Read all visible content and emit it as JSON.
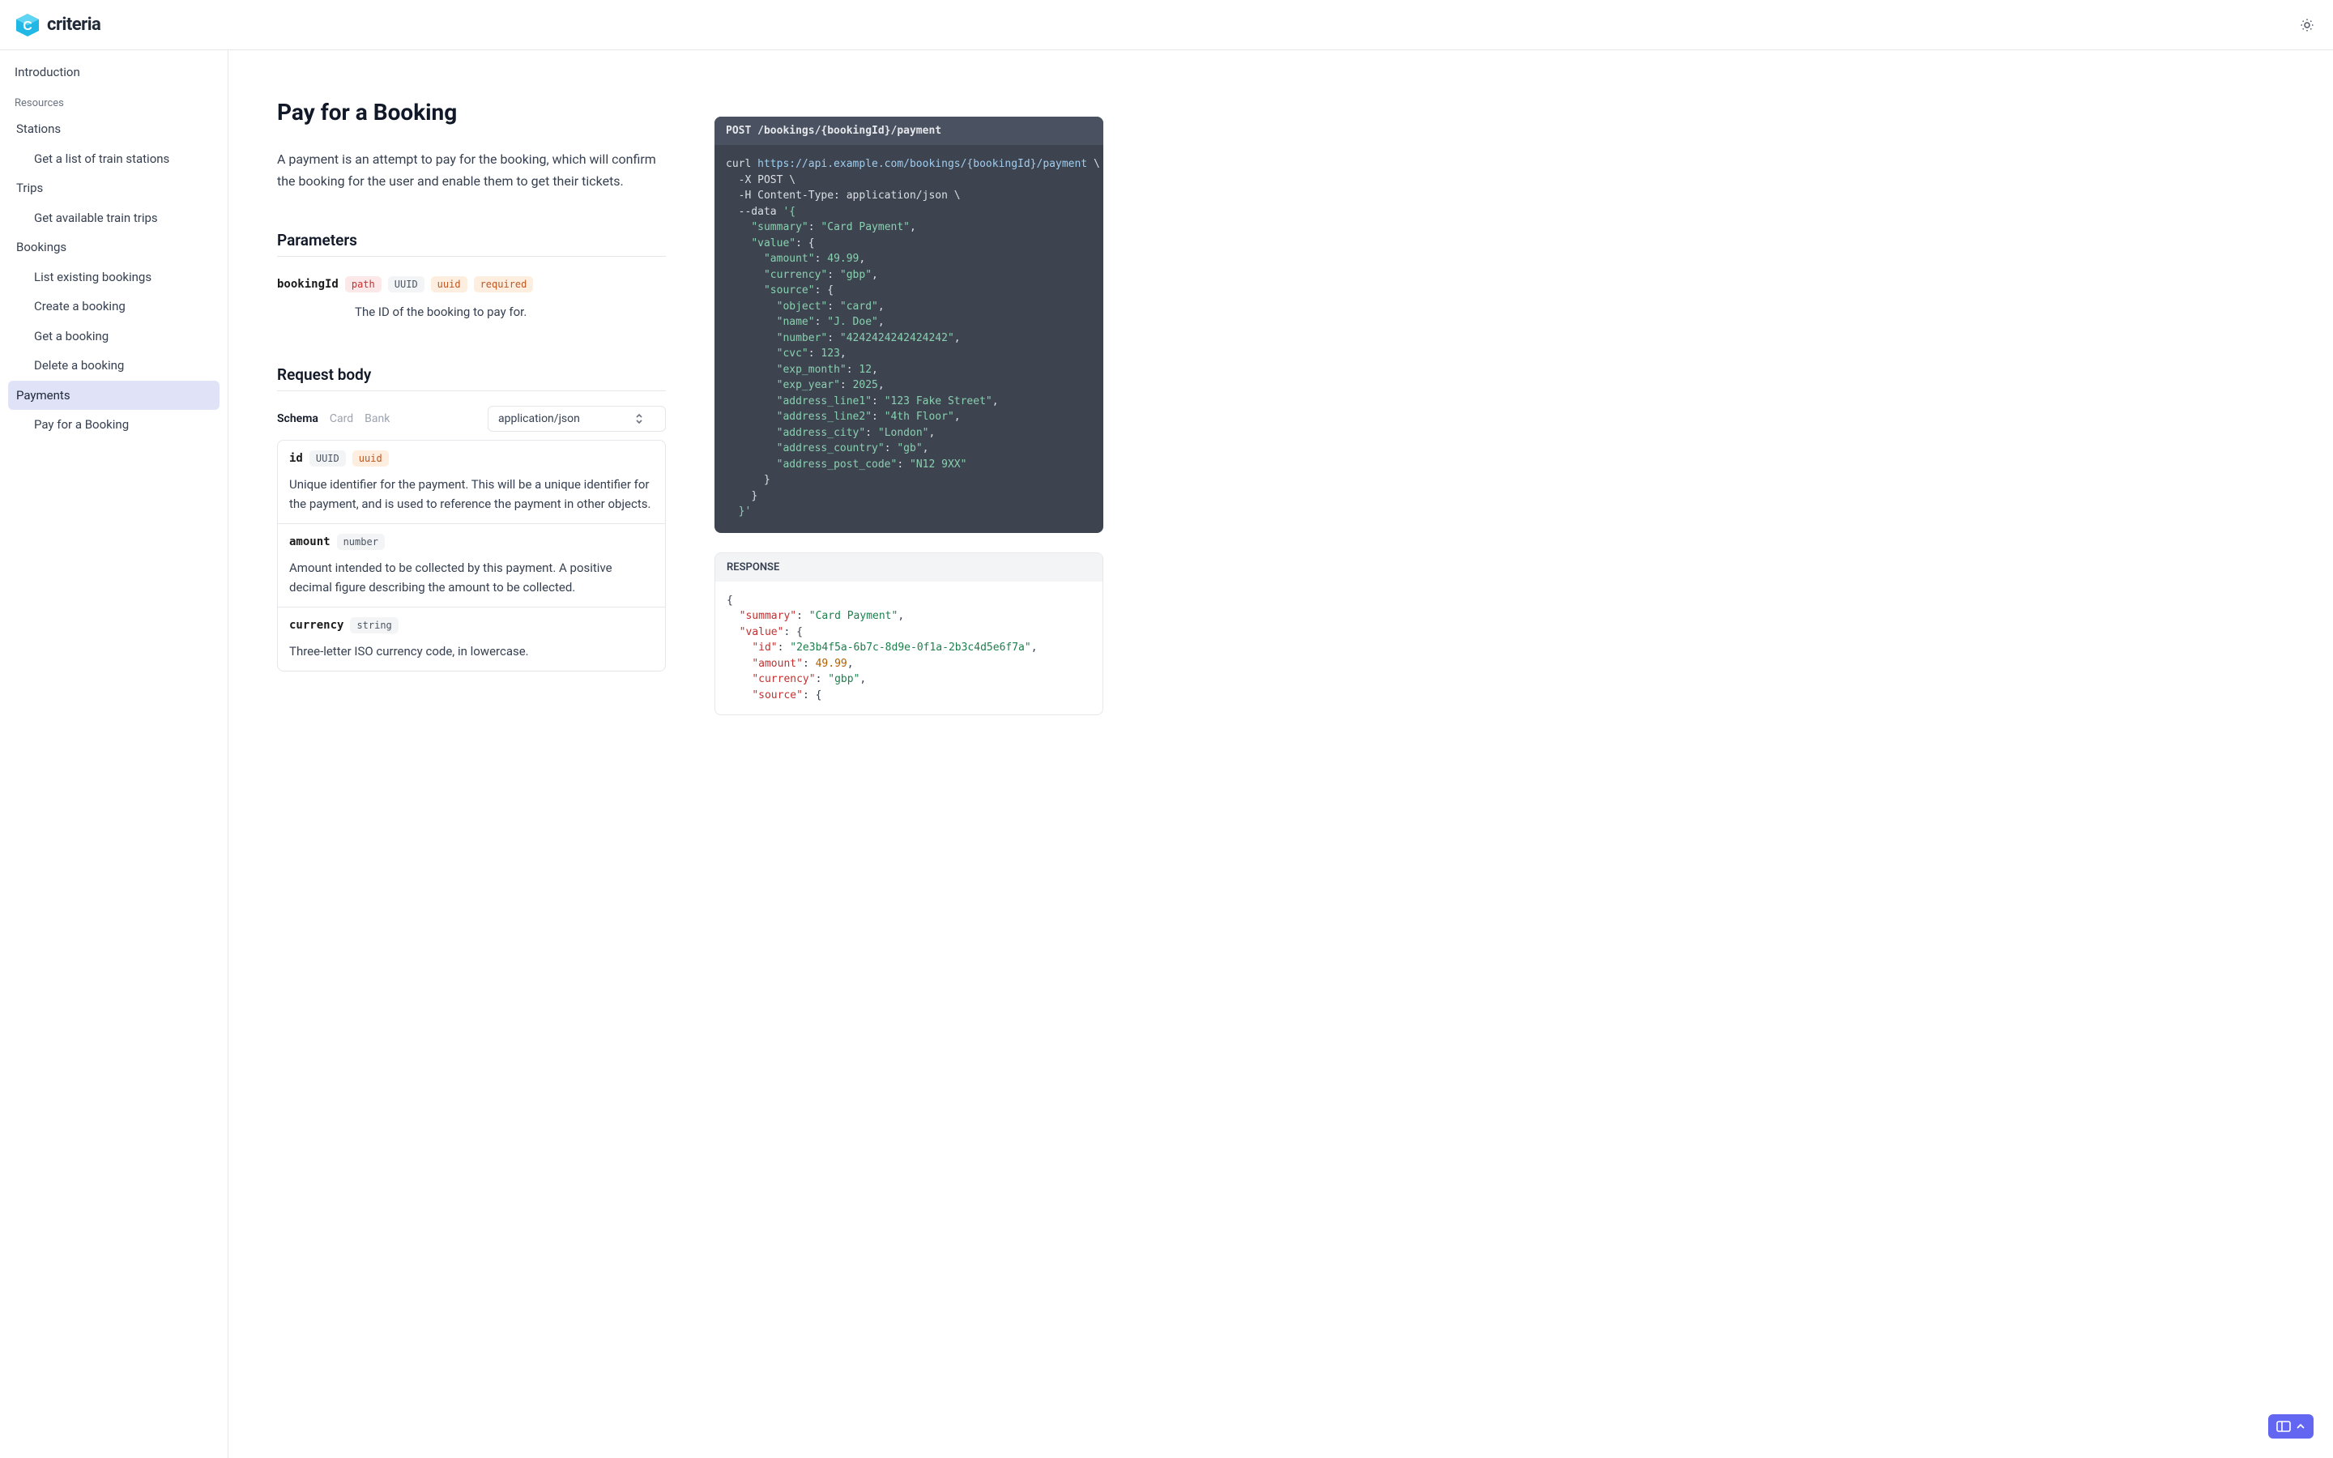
{
  "brand": "criteria",
  "sidebar": {
    "intro": "Introduction",
    "resources_label": "Resources",
    "stations": "Stations",
    "stations_list": "Get a list of train stations",
    "trips": "Trips",
    "trips_list": "Get available train trips",
    "bookings": "Bookings",
    "bookings_list": "List existing bookings",
    "bookings_create": "Create a booking",
    "bookings_get": "Get a booking",
    "bookings_delete": "Delete a booking",
    "payments": "Payments",
    "payments_pay": "Pay for a Booking"
  },
  "page": {
    "title": "Pay for a Booking",
    "description": "A payment is an attempt to pay for the booking, which will confirm the booking for the user and enable them to get their tickets.",
    "parameters_heading": "Parameters",
    "request_body_heading": "Request body"
  },
  "param": {
    "name": "bookingId",
    "chip_path": "path",
    "chip_type": "UUID",
    "chip_format": "uuid",
    "chip_required": "required",
    "desc": "The ID of the booking to pay for."
  },
  "schema_tabs": {
    "schema": "Schema",
    "card": "Card",
    "bank": "Bank"
  },
  "content_type": "application/json",
  "body_fields": {
    "id": {
      "name": "id",
      "type": "UUID",
      "format": "uuid",
      "desc": "Unique identifier for the payment. This will be a unique identifier for the payment, and is used to reference the payment in other objects."
    },
    "amount": {
      "name": "amount",
      "type": "number",
      "desc": "Amount intended to be collected by this payment. A positive decimal figure describing the amount to be collected."
    },
    "currency": {
      "name": "currency",
      "type": "string",
      "desc": "Three-letter ISO currency code, in lowercase."
    }
  },
  "code": {
    "method": "POST",
    "path": "/bookings/{bookingId}/payment",
    "curl_url": "https://api.example.com/bookings/{bookingId}/payment",
    "http_method": "POST",
    "content_type_header": "Content-Type: application/json",
    "payload": {
      "summary": "Card Payment",
      "value": {
        "amount": 49.99,
        "currency": "gbp",
        "source": {
          "object": "card",
          "name": "J. Doe",
          "number": "4242424242424242",
          "cvc": 123,
          "exp_month": 12,
          "exp_year": 2025,
          "address_line1": "123 Fake Street",
          "address_line2": "4th Floor",
          "address_city": "London",
          "address_country": "gb",
          "address_post_code": "N12 9XX"
        }
      }
    }
  },
  "response": {
    "label": "RESPONSE",
    "body": {
      "summary": "Card Payment",
      "value": {
        "id": "2e3b4f5a-6b7c-8d9e-0f1a-2b3c4d5e6f7a",
        "amount": 49.99,
        "currency": "gbp",
        "source": "{"
      }
    }
  }
}
